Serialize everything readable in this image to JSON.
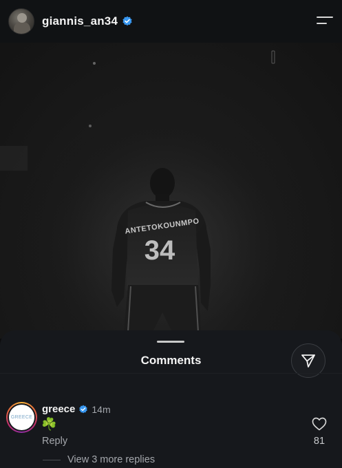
{
  "header": {
    "username": "giannis_an34",
    "verified_icon": "verified-badge-icon",
    "menu_icon": "menu-icon"
  },
  "post": {
    "photo_icon": "basketball-player-photo",
    "jersey_name": "ANTETOKOUNMPO",
    "jersey_number": "34"
  },
  "comments_sheet": {
    "title": "Comments",
    "share_icon": "send-icon",
    "comments": [
      {
        "username": "greece",
        "verified": true,
        "time": "14m",
        "text": "☘️",
        "avatar_text": "GREECE",
        "reply_label": "Reply",
        "like_count": "81",
        "view_replies_label": "View 3 more replies"
      }
    ]
  },
  "colors": {
    "verified_blue": "#3897f0",
    "background": "#16181c",
    "secondary_text": "#a4a7ac"
  }
}
